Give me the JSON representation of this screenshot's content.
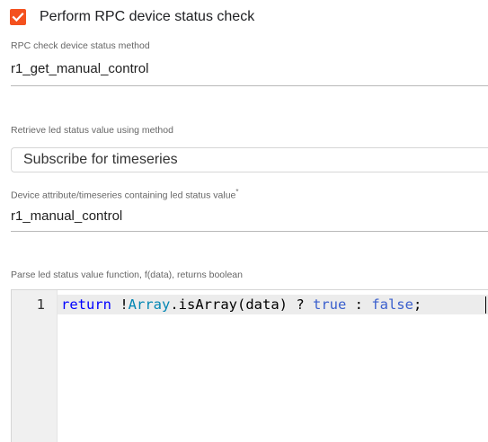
{
  "rpc_check": {
    "checkbox_label": "Perform RPC device status check",
    "checked": true,
    "accent_color": "#f4511e"
  },
  "rpc_method": {
    "label": "RPC check device status method",
    "value": "r1_get_manual_control"
  },
  "retrieve_method": {
    "label": "Retrieve led status value using method",
    "selected": "Subscribe for timeseries"
  },
  "status_key": {
    "label": "Device attribute/timeseries containing led status value",
    "required_mark": "*",
    "value": "r1_manual_control"
  },
  "parse_function": {
    "label": "Parse led status value function, f(data), returns boolean",
    "line_number": "1",
    "code": {
      "keyword_return": "return",
      "op_not": " !",
      "builtin_array": "Array",
      "call": ".isArray(data) ? ",
      "lit_true": "true",
      "op_colon": " : ",
      "lit_false": "false",
      "semicolon": ";"
    }
  }
}
